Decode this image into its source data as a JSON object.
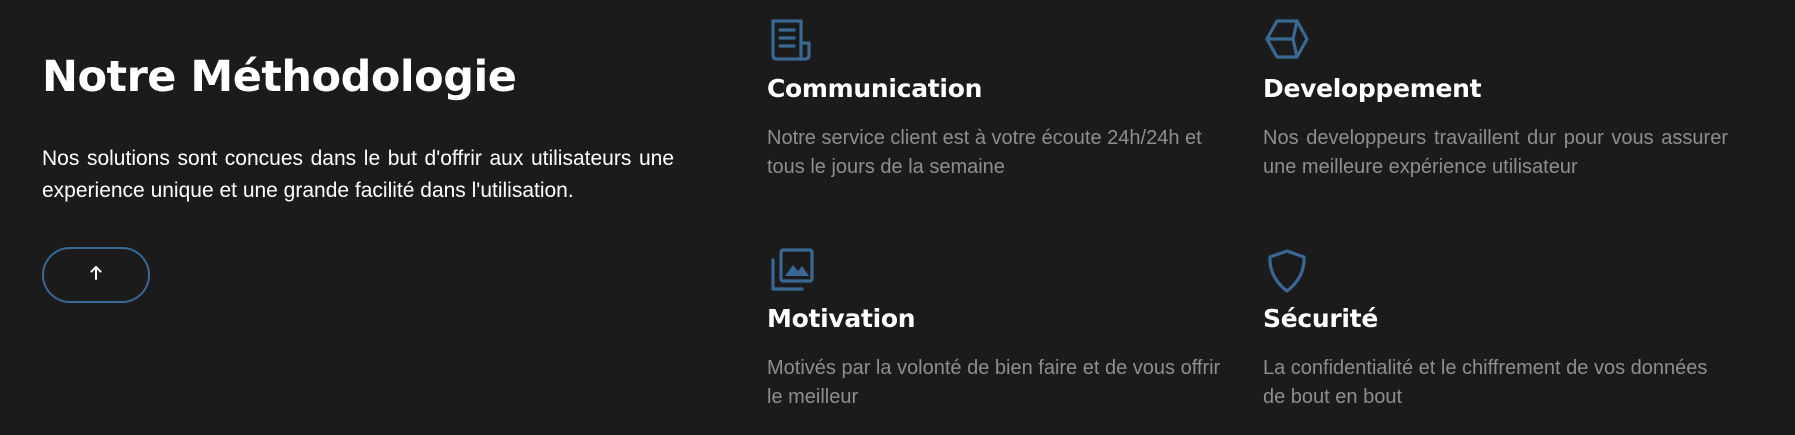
{
  "methodology": {
    "title": "Notre Méthodologie",
    "description": "Nos solutions sont concues dans le but d'offrir aux utilisateurs une experience unique et une grande facilité dans l'utilisation.",
    "up_button_icon": "arrow-up-icon",
    "accent_color": "#3a6894"
  },
  "features": [
    {
      "icon": "newspaper-icon",
      "title": "Communication",
      "text": "Notre service client est à votre écoute 24h/24h et tous le jours de la semaine"
    },
    {
      "icon": "cube-icon",
      "title": "Developpement",
      "text": "Nos developpeurs travaillent dur pour vous assurer une meilleure expérience utilisateur"
    },
    {
      "icon": "images-icon",
      "title": "Motivation",
      "text": "Motivés par la volonté de bien faire et de vous offrir le meilleur"
    },
    {
      "icon": "shield-icon",
      "title": "Sécurité",
      "text": "La confidentialité et le chiffrement de vos données de bout en bout"
    }
  ]
}
